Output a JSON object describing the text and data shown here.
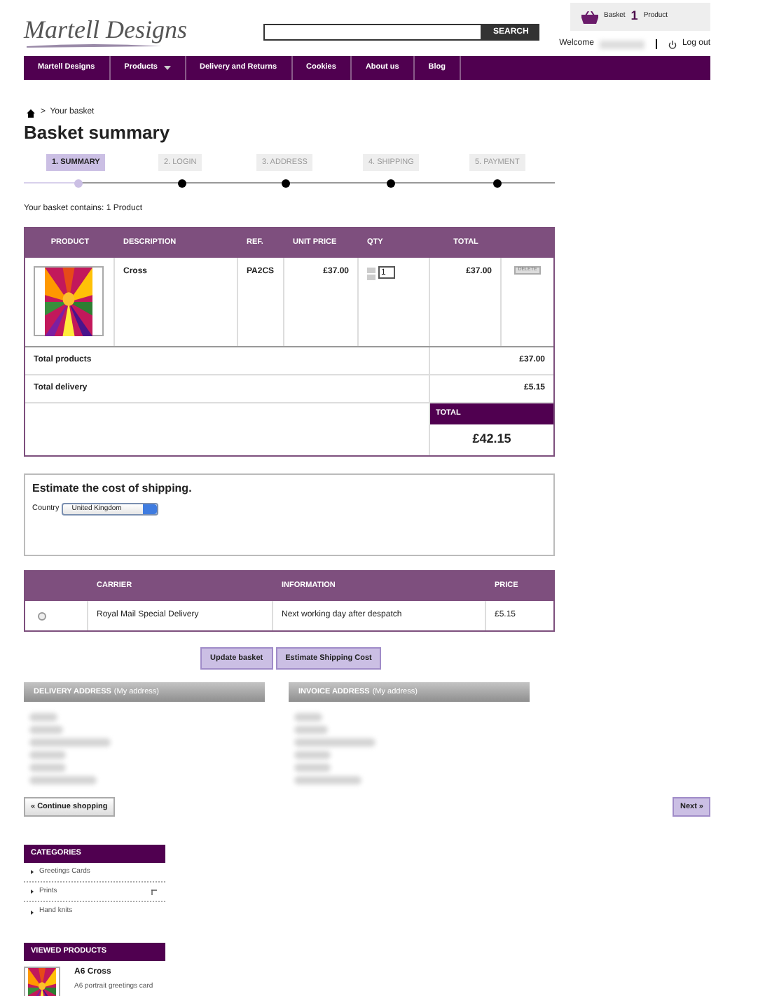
{
  "header": {
    "logo": "Martell Designs",
    "search": {
      "button": "SEARCH"
    },
    "basket": {
      "label": "Basket",
      "count": "1",
      "unit": "Product"
    },
    "welcome": "Welcome",
    "logout": "Log out"
  },
  "nav": [
    {
      "label": "Martell Designs",
      "dropdown": false
    },
    {
      "label": "Products",
      "dropdown": true
    },
    {
      "label": "Delivery and Returns",
      "dropdown": false
    },
    {
      "label": "Cookies",
      "dropdown": false
    },
    {
      "label": "About us",
      "dropdown": false
    },
    {
      "label": "Blog",
      "dropdown": false
    }
  ],
  "breadcrumb": ">  Your basket",
  "title": "Basket summary",
  "steps": [
    {
      "label": "1. SUMMARY",
      "selected": true
    },
    {
      "label": "2. LOGIN",
      "selected": false
    },
    {
      "label": "3. ADDRESS",
      "selected": false
    },
    {
      "label": "4. SHIPPING",
      "selected": false
    },
    {
      "label": "5. PAYMENT",
      "selected": false
    }
  ],
  "basket_contains": "Your basket contains: 1 Product",
  "cart": {
    "columns": [
      "PRODUCT",
      "DESCRIPTION",
      "REF.",
      "UNIT PRICE",
      "QTY",
      "TOTAL"
    ],
    "rows": [
      {
        "description": "Cross",
        "ref": "PA2CS",
        "unit_price": "£37.00",
        "qty": "1",
        "total": "£37.00",
        "delete": "DELETE"
      }
    ],
    "total_products": {
      "label": "Total products",
      "value": "£37.00"
    },
    "total_delivery": {
      "label": "Total delivery",
      "value": "£5.15"
    },
    "total": {
      "label": "TOTAL",
      "value": "£42.15"
    }
  },
  "estimate": {
    "title": "Estimate the cost of shipping.",
    "country_label": "Country",
    "country": "United Kingdom"
  },
  "carriers": {
    "columns": [
      "CARRIER",
      "INFORMATION",
      "PRICE"
    ],
    "rows": [
      {
        "selected": false,
        "carrier": "Royal Mail Special Delivery",
        "information": "Next working day after despatch",
        "price": "£5.15"
      }
    ]
  },
  "actions": [
    "Update basket",
    "Estimate Shipping Cost"
  ],
  "addresses": [
    {
      "title": "DELIVERY ADDRESS",
      "note": "(My address)"
    },
    {
      "title": "INVOICE ADDRESS",
      "note": "(My address)"
    }
  ],
  "continue": "« Continue shopping",
  "next": "Next »",
  "categories": {
    "title": "CATEGORIES",
    "items": [
      {
        "label": "Greetings Cards",
        "expandable": false
      },
      {
        "label": "Prints",
        "expandable": true
      },
      {
        "label": "Hand knits",
        "expandable": false
      }
    ]
  },
  "viewed": {
    "title": "VIEWED PRODUCTS",
    "items": [
      {
        "name": "A6 Cross",
        "description": "A6 portrait greetings card"
      }
    ]
  }
}
